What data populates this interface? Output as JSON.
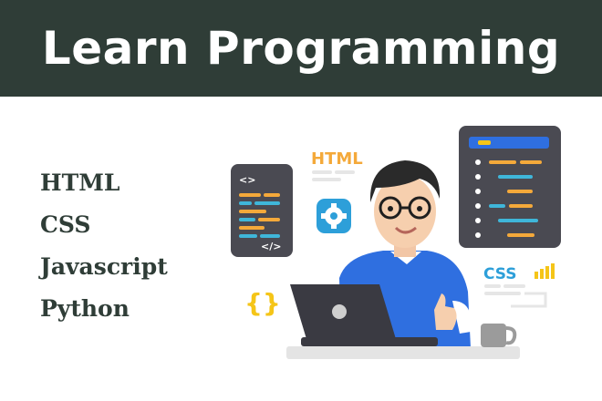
{
  "header": {
    "title": "Learn Programming"
  },
  "topics": [
    "HTML",
    "CSS",
    "Javascript",
    "Python"
  ],
  "illustration": {
    "html_label": "HTML",
    "css_label": "CSS",
    "code_open_tag": "<>",
    "code_close_tag": "</>",
    "braces": "{}",
    "icons": [
      "code-window-icon",
      "gear-icon",
      "curly-braces-icon",
      "signal-bars-icon",
      "laptop-icon",
      "coffee-mug-icon"
    ]
  },
  "colors": {
    "banner_bg": "#2f3d37",
    "banner_text": "#ffffff",
    "topic_text": "#2f3d37",
    "panel_bg": "#4a4a52",
    "html_orange": "#f4a93a",
    "css_blue": "#2d9fd9",
    "code_teal": "#3fb6d9",
    "shirt_blue": "#2f6fe0",
    "accent_yellow": "#f5c518"
  }
}
